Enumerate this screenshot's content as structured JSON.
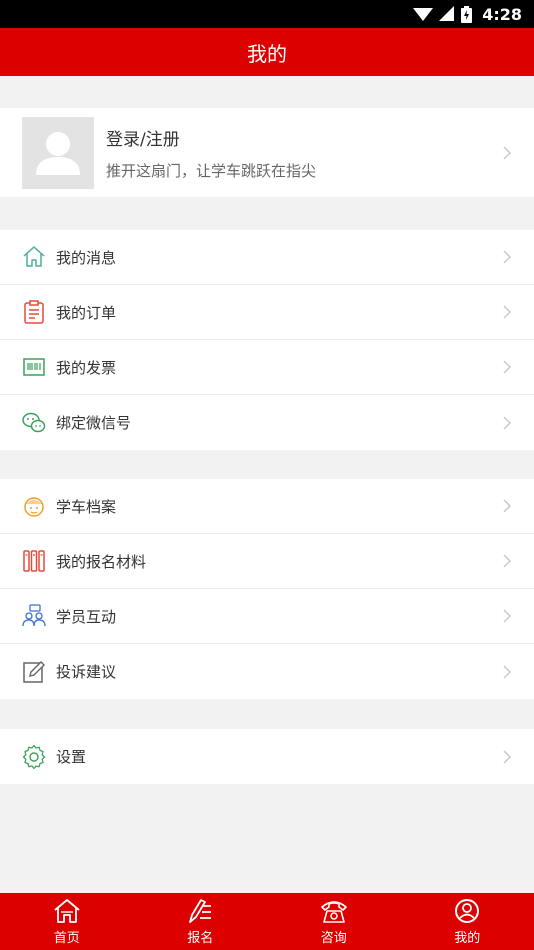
{
  "status": {
    "time": "4:28"
  },
  "header": {
    "title": "我的"
  },
  "profile": {
    "name": "登录/注册",
    "subtitle": "推开这扇门，让学车跳跃在指尖"
  },
  "groups": [
    {
      "items": [
        {
          "label": "我的消息",
          "icon": "home-outline-icon",
          "color": "#4caf9a"
        },
        {
          "label": "我的订单",
          "icon": "clipboard-icon",
          "color": "#e84a3a"
        },
        {
          "label": "我的发票",
          "icon": "invoice-icon",
          "color": "#3aa35a"
        },
        {
          "label": "绑定微信号",
          "icon": "wechat-icon",
          "color": "#3aa35a"
        }
      ]
    },
    {
      "items": [
        {
          "label": "学车档案",
          "icon": "student-avatar-icon",
          "color": "#f0a020"
        },
        {
          "label": "我的报名材料",
          "icon": "binders-icon",
          "color": "#e84a3a"
        },
        {
          "label": "学员互动",
          "icon": "chat-group-icon",
          "color": "#3a6fd8"
        },
        {
          "label": "投诉建议",
          "icon": "edit-note-icon",
          "color": "#666666"
        }
      ]
    },
    {
      "items": [
        {
          "label": "设置",
          "icon": "gear-icon",
          "color": "#3aa35a"
        }
      ]
    }
  ],
  "tabbar": [
    {
      "label": "首页",
      "icon": "home-icon"
    },
    {
      "label": "报名",
      "icon": "signup-pen-icon"
    },
    {
      "label": "咨询",
      "icon": "telephone-icon"
    },
    {
      "label": "我的",
      "icon": "user-circle-icon"
    }
  ],
  "colors": {
    "brand": "#dd0000",
    "background": "#f2f2f2"
  }
}
